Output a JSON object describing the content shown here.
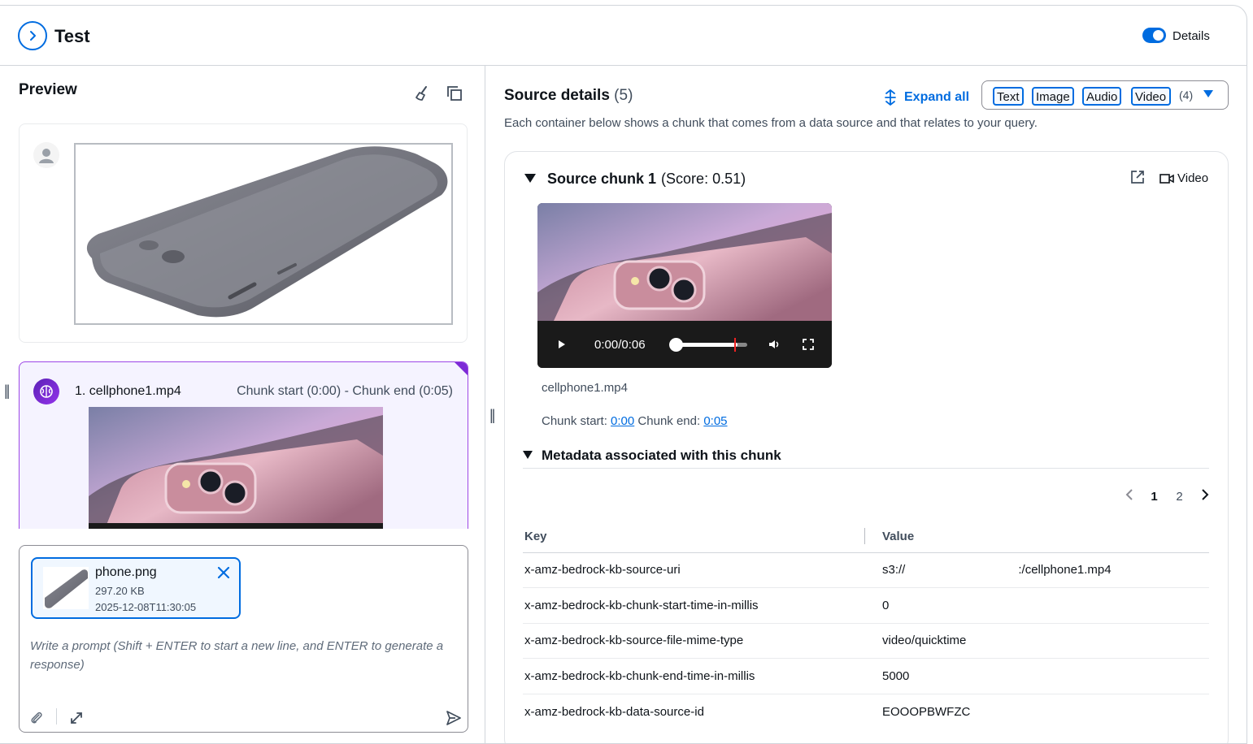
{
  "header": {
    "title": "Test",
    "details_label": "Details"
  },
  "preview": {
    "title": "Preview",
    "result": {
      "file": "1. cellphone1.mp4",
      "chunk_range": "Chunk start (0:00) - Chunk end (0:05)"
    },
    "attachment": {
      "name": "phone.png",
      "size": "297.20 KB",
      "date": "2025-12-08T11:30:05"
    },
    "prompt_placeholder": "Write a prompt (Shift + ENTER to start a new line, and ENTER to generate a response)"
  },
  "source_details": {
    "title": "Source details",
    "count": "(5)",
    "description": "Each container below shows a chunk that comes from a data source and that relates to your query.",
    "expand_all": "Expand all",
    "filters": [
      "Text",
      "Image",
      "Audio",
      "Video"
    ],
    "filter_count": "(4)",
    "chunk": {
      "title": "Source chunk 1",
      "score": "(Score: 0.51)",
      "type_label": "Video",
      "video_time": "0:00/0:06",
      "file_name": "cellphone1.mp4",
      "chunk_start_label": "Chunk start:",
      "chunk_start": "0:00",
      "chunk_end_label": "Chunk end:",
      "chunk_end": "0:05",
      "metadata_title": "Metadata associated with this chunk",
      "pages": [
        "1",
        "2"
      ],
      "columns": [
        "Key",
        "Value"
      ],
      "rows": [
        {
          "key": "x-amz-bedrock-kb-source-uri",
          "value": "s3://",
          "value_suffix": ":/cellphone1.mp4"
        },
        {
          "key": "x-amz-bedrock-kb-chunk-start-time-in-millis",
          "value": "0"
        },
        {
          "key": "x-amz-bedrock-kb-source-file-mime-type",
          "value": "video/quicktime"
        },
        {
          "key": "x-amz-bedrock-kb-chunk-end-time-in-millis",
          "value": "5000"
        },
        {
          "key": "x-amz-bedrock-kb-data-source-id",
          "value": "EOOOPBWFZC"
        }
      ]
    }
  },
  "colors": {
    "accent": "#006ce0",
    "bot_border": "#9c46e6",
    "link": "#006ce0"
  }
}
